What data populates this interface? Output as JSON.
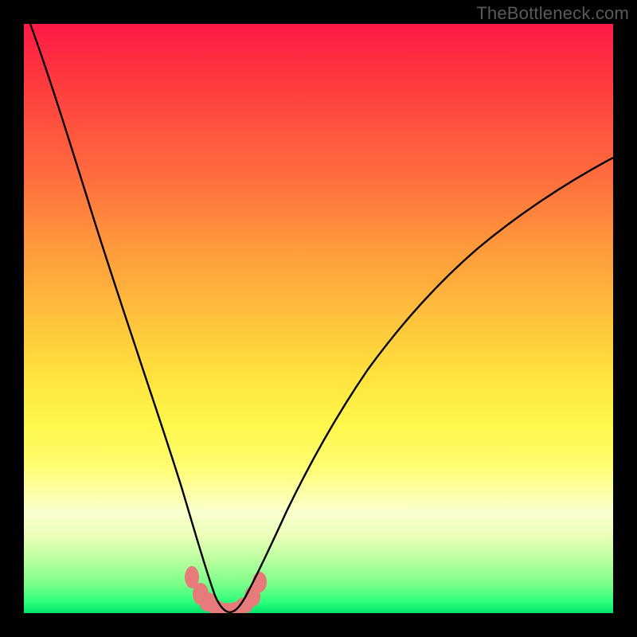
{
  "attribution": "TheBottleneck.com",
  "chart_data": {
    "type": "line",
    "title": "",
    "xlabel": "",
    "ylabel": "",
    "xlim": [
      0,
      100
    ],
    "ylim": [
      0,
      100
    ],
    "grid": false,
    "legend": false,
    "notes": "Vertical axis reads as bottleneck percentage (0% bottom/green, ~100% top/red). The curve dips to 0 near x≈33, indicating the sweet-spot. Small salmon markers highlight the near-zero region.",
    "series": [
      {
        "name": "bottleneck-curve",
        "color": "#000000",
        "x": [
          0,
          2,
          4,
          6,
          8,
          10,
          12,
          14,
          16,
          18,
          20,
          22,
          24,
          26,
          28,
          30,
          31,
          32,
          33,
          34,
          35,
          36,
          38,
          40,
          44,
          48,
          52,
          56,
          60,
          64,
          68,
          72,
          76,
          80,
          84,
          88,
          92,
          96,
          100
        ],
        "y": [
          100,
          99,
          97,
          95,
          92,
          88,
          84,
          79,
          73,
          67,
          60,
          52,
          43,
          34,
          24,
          13,
          8,
          4,
          1,
          0,
          1,
          2,
          5,
          9,
          17,
          24,
          30,
          35,
          40,
          44,
          48,
          52,
          55,
          58,
          61,
          64,
          66,
          68,
          70
        ]
      },
      {
        "name": "sweet-spot-markers",
        "color": "#e77b7b",
        "marker_shape": "rounded-blob",
        "x": [
          28.5,
          30,
          31,
          32,
          33,
          34,
          35,
          36,
          37.5
        ],
        "y": [
          6,
          3,
          1.5,
          0.8,
          0.5,
          0.5,
          0.8,
          2,
          5
        ]
      }
    ]
  },
  "colors": {
    "frame": "#000000",
    "curve": "#000000",
    "marker": "#e77b7b",
    "attribution_text": "#5a5a5a"
  }
}
